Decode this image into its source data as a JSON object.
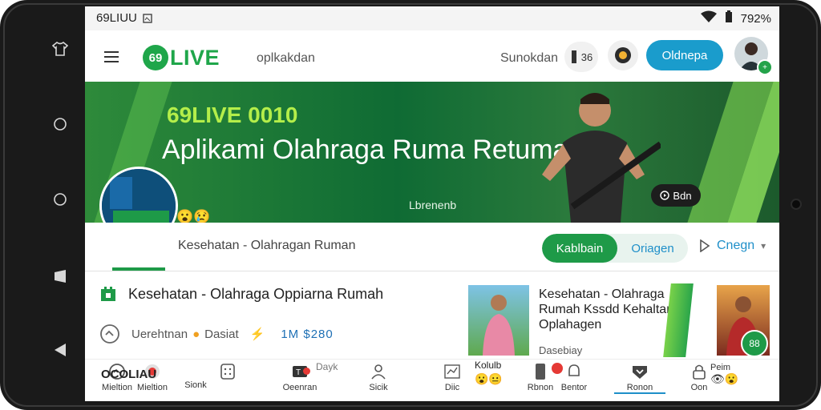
{
  "status_bar": {
    "time": "69LIUU",
    "battery": "792%"
  },
  "header": {
    "logo_mark": "69",
    "logo_text": "LIVE",
    "nav_link": "oplkakdan",
    "search_label": "Sunokdan",
    "coin_count": "36",
    "primary_button": "Oldnepa"
  },
  "banner": {
    "kicker": "69LIVE 0010",
    "title": "Aplikami Olahraga Ruma Retumal",
    "subtitle": "Lbrenenb",
    "pill_label": "Bdn"
  },
  "channel": {
    "name": "Kesehatan - Olahragan Ruman",
    "tab_active": "Kablbain",
    "tab_inactive": "Oriagen",
    "play_link": "Cnegn"
  },
  "content": {
    "title": "Kesehatan - Olahraga Oppiarna Rumah",
    "stat_label": "Uerehtnan",
    "stat_tag": "Dasiat",
    "stat_value": "1M $280",
    "bottom_label": "OCOLIAU"
  },
  "cards": [
    {
      "title": "Kesehatan - Olahraga Rumah Kssdd Kehaltan Oplahagen",
      "meta": "Dasebiay"
    },
    {
      "badge": "88"
    }
  ],
  "bottom_nav": [
    {
      "label": "Mieltion",
      "icon": "chat-icon"
    },
    {
      "label": "Sionk",
      "icon": "tag-icon"
    },
    {
      "label": "",
      "icon": "grid-icon"
    },
    {
      "label": "Oeenran",
      "icon": "tv-icon"
    },
    {
      "label": "Sicik",
      "icon": "person-icon"
    },
    {
      "label": "Diic",
      "icon": "chart-icon"
    },
    {
      "label": "Rbnon",
      "icon": "phone-icon"
    },
    {
      "label": "Bentor",
      "icon": "bell-icon"
    },
    {
      "label": "Ronon",
      "icon": "shield-icon"
    },
    {
      "label": "Oon",
      "icon": "lock-icon"
    },
    {
      "label": "Peim",
      "icon": "misc-icon"
    }
  ],
  "bottom_extra": {
    "day_label": "Dayk",
    "left_tag": "Kolulb"
  },
  "colors": {
    "brand_green": "#1fa64a",
    "accent_blue": "#1a9ccc",
    "tab_green": "#1e9a48"
  }
}
